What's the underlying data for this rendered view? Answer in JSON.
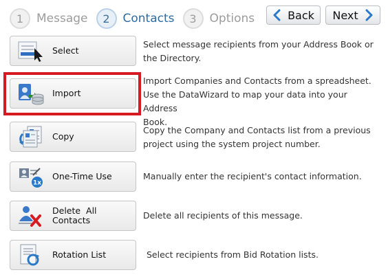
{
  "wizard": {
    "steps": [
      {
        "number": "1",
        "label": "Message"
      },
      {
        "number": "2",
        "label": "Contacts"
      },
      {
        "number": "3",
        "label": "Options"
      }
    ],
    "active_step": 2
  },
  "nav": {
    "back_label": "Back",
    "next_label": "Next"
  },
  "actions": [
    {
      "label": "Select",
      "icon": "address-book-icon",
      "desc_lines": [
        "Select message recipients from your Address Book or",
        "the Directory."
      ]
    },
    {
      "label": "Import",
      "icon": "import-database-icon",
      "desc_lines": [
        "Import Companies and Contacts from a spreadsheet.",
        "Use the DataWizard to map your data into your Address",
        "Book."
      ]
    },
    {
      "label": "Copy",
      "icon": "copy-list-icon",
      "desc_lines": [
        "Copy the Company and Contacts list from a previous",
        "project using the system project number."
      ]
    },
    {
      "label": "One-Time Use",
      "icon": "one-time-use-icon",
      "desc_lines": [
        "Manually enter the recipient's contact information."
      ]
    },
    {
      "label_lines": [
        "Delete  All",
        "Contacts"
      ],
      "icon": "delete-contacts-icon",
      "desc_lines": [
        "Delete all recipients of this message."
      ]
    },
    {
      "label": "Rotation List",
      "icon": "rotation-list-icon",
      "desc_lines": [
        "Select recipients from Bid Rotation lists."
      ]
    }
  ],
  "highlighted_action": "Import",
  "colors": {
    "active_step": "#2f6a9e",
    "inactive_step": "#9c9c9c",
    "highlight_border": "#d71a20",
    "chevron": "#2a78c8"
  }
}
